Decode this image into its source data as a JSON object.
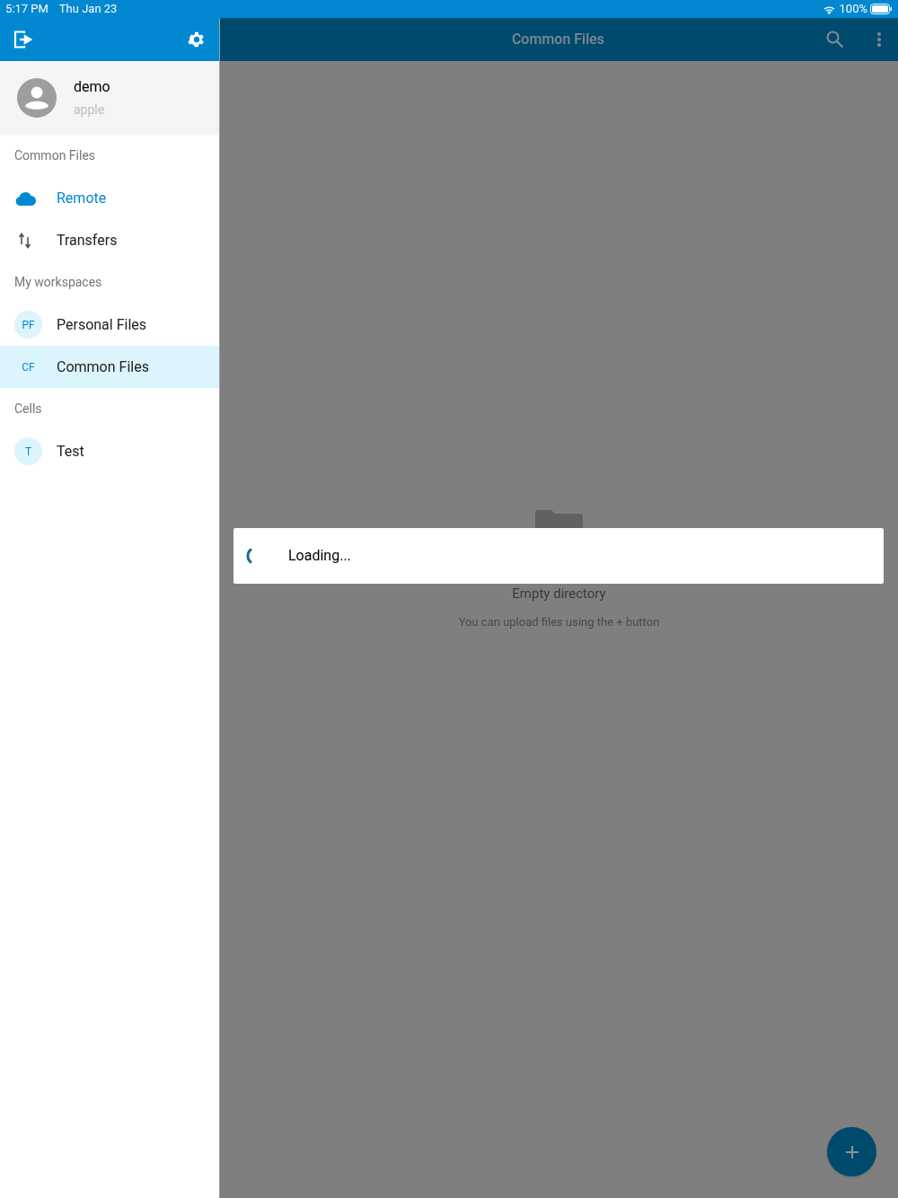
{
  "status_bar": {
    "time": "5:17 PM",
    "date": "Thu Jan 23",
    "battery": "100%"
  },
  "sidebar": {
    "user": {
      "name": "demo",
      "account": "apple"
    },
    "sections": [
      {
        "title": "Common Files",
        "items": [
          {
            "kind": "nav",
            "label": "Remote",
            "selected": true
          },
          {
            "kind": "nav",
            "label": "Transfers",
            "selected": false
          }
        ]
      },
      {
        "title": "My workspaces",
        "items": [
          {
            "kind": "workspace",
            "initials": "PF",
            "label": "Personal Files",
            "selected": false
          },
          {
            "kind": "workspace",
            "initials": "CF",
            "label": "Common Files",
            "selected": true
          }
        ]
      },
      {
        "title": "Cells",
        "items": [
          {
            "kind": "workspace",
            "initials": "T",
            "label": "Test",
            "selected": false
          }
        ]
      }
    ]
  },
  "toolbar": {
    "title": "Common Files"
  },
  "empty_state": {
    "title": "Empty directory",
    "hint": "You can upload files using the + button"
  },
  "dialog": {
    "message": "Loading..."
  }
}
